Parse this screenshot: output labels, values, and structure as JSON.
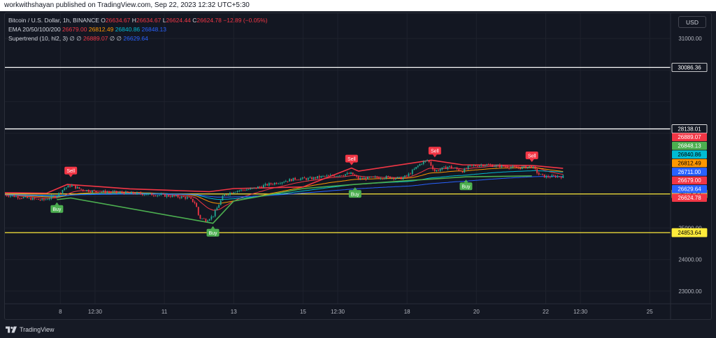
{
  "header": {
    "publisher_text": "workwithshayan published on TradingView.com, Sep 22, 2023 12:32 UTC+5:30"
  },
  "legend": {
    "symbol": "Bitcoin / U.S. Dollar, 1h, BINANCE",
    "o_label": "O",
    "o_value": "26634.67",
    "h_label": "H",
    "h_value": "26634.67",
    "l_label": "L",
    "l_value": "26624.44",
    "c_label": "C",
    "c_value": "26624.78",
    "change": "−12.89 (−0.05%)",
    "ema_label": "EMA 20/50/100/200",
    "ema_values": [
      "26679.00",
      "26812.49",
      "26840.86",
      "26848.13"
    ],
    "supertrend_label": "Supertrend (10, hl2, 3)",
    "st_placeholder": "∅",
    "st_values": [
      "26889.07",
      "26629.64"
    ]
  },
  "currency_button": "USD",
  "footer": {
    "brand": "TradingView"
  },
  "colors": {
    "background": "#131722",
    "grid": "#1e222d",
    "candle_up": "#22ab94",
    "candle_down": "#f23645",
    "supertrend_up": "#4caf50",
    "supertrend_down": "#f23645",
    "ema20": "#f23645",
    "ema50": "#ff9800",
    "ema100": "#00bcd4",
    "ema200": "#2962ff",
    "hline_white": "#ffffff",
    "hline_yellow": "#ffeb3b"
  },
  "chart_data": {
    "type": "candlestick",
    "symbol": "BTCUSD",
    "timeframe": "1h",
    "ylim": [
      22600,
      31800
    ],
    "x_ticks": [
      {
        "label": "8",
        "day": 8.0
      },
      {
        "label": "12:30",
        "day": 9.0
      },
      {
        "label": "11",
        "day": 11.0
      },
      {
        "label": "13",
        "day": 13.0
      },
      {
        "label": "15",
        "day": 15.0
      },
      {
        "label": "12:30",
        "day": 16.0
      },
      {
        "label": "18",
        "day": 18.0
      },
      {
        "label": "20",
        "day": 20.0
      },
      {
        "label": "22",
        "day": 22.0
      },
      {
        "label": "12:30",
        "day": 23.0
      },
      {
        "label": "25",
        "day": 25.0
      }
    ],
    "y_ticks": [
      31000,
      25000,
      24000,
      23000
    ],
    "y_tick_labels": [
      "31000.00",
      "25000.00",
      "24000.00",
      "23000.00"
    ],
    "horizontal_lines": [
      {
        "value": 30086.36,
        "label": "30086.36",
        "color": "white"
      },
      {
        "value": 28138.01,
        "label": "28138.01",
        "color": "white"
      },
      {
        "value": 26078.32,
        "label": "26078.32",
        "color": "yellow"
      },
      {
        "value": 24853.64,
        "label": "24853.64",
        "color": "yellow"
      }
    ],
    "price_tags": [
      {
        "label": "26889.07",
        "value": 26889.07,
        "bg": "#f23645",
        "fg": "#ffffff"
      },
      {
        "label": "26848.13",
        "value": 26848.13,
        "bg": "#4caf50",
        "fg": "#ffffff"
      },
      {
        "label": "26840.86",
        "value": 26840.86,
        "bg": "#00bcd4",
        "fg": "#000000"
      },
      {
        "label": "26812.49",
        "value": 26812.49,
        "bg": "#ff9800",
        "fg": "#000000"
      },
      {
        "label": "26711.00",
        "value": 26711.0,
        "bg": "#2962ff",
        "fg": "#ffffff"
      },
      {
        "label": "26679.00",
        "value": 26679.0,
        "bg": "#f23645",
        "fg": "#ffffff"
      },
      {
        "label": "26629.64",
        "value": 26629.64,
        "bg": "#2962ff",
        "fg": "#ffffff"
      },
      {
        "label": "26624.78",
        "value": 26624.78,
        "bg": "#f23645",
        "fg": "#ffffff"
      }
    ],
    "signals": [
      {
        "type": "Buy",
        "day": 7.9,
        "price": 25900
      },
      {
        "type": "Sell",
        "day": 8.3,
        "price": 26520
      },
      {
        "type": "Buy",
        "day": 12.4,
        "price": 25150
      },
      {
        "type": "Sell",
        "day": 16.4,
        "price": 26900
      },
      {
        "type": "Buy",
        "day": 16.5,
        "price": 26380
      },
      {
        "type": "Sell",
        "day": 18.8,
        "price": 27150
      },
      {
        "type": "Buy",
        "day": 19.7,
        "price": 26620
      },
      {
        "type": "Sell",
        "day": 21.6,
        "price": 27000
      }
    ],
    "close_path": [
      [
        6.4,
        26050
      ],
      [
        7.0,
        25950
      ],
      [
        7.5,
        25880
      ],
      [
        7.9,
        26030
      ],
      [
        8.1,
        26250
      ],
      [
        8.3,
        26350
      ],
      [
        8.6,
        26220
      ],
      [
        9.0,
        26150
      ],
      [
        9.6,
        26130
      ],
      [
        10.2,
        26090
      ],
      [
        10.8,
        26050
      ],
      [
        11.3,
        26000
      ],
      [
        11.7,
        25950
      ],
      [
        11.9,
        25780
      ],
      [
        12.0,
        25330
      ],
      [
        12.2,
        25250
      ],
      [
        12.4,
        25380
      ],
      [
        12.7,
        26020
      ],
      [
        13.0,
        26170
      ],
      [
        13.5,
        26230
      ],
      [
        14.0,
        26380
      ],
      [
        14.4,
        26470
      ],
      [
        14.8,
        26560
      ],
      [
        15.2,
        26560
      ],
      [
        15.5,
        26620
      ],
      [
        15.9,
        26660
      ],
      [
        16.2,
        26700
      ],
      [
        16.4,
        26720
      ],
      [
        16.6,
        26560
      ],
      [
        17.0,
        26590
      ],
      [
        17.5,
        26610
      ],
      [
        17.8,
        26570
      ],
      [
        18.0,
        26650
      ],
      [
        18.2,
        26850
      ],
      [
        18.4,
        27050
      ],
      [
        18.6,
        27150
      ],
      [
        18.8,
        26800
      ],
      [
        19.2,
        26950
      ],
      [
        19.6,
        26800
      ],
      [
        19.8,
        26950
      ],
      [
        20.2,
        27000
      ],
      [
        20.8,
        26950
      ],
      [
        21.2,
        26900
      ],
      [
        21.6,
        26950
      ],
      [
        21.8,
        26700
      ],
      [
        22.0,
        26620
      ],
      [
        22.3,
        26640
      ],
      [
        22.5,
        26625
      ]
    ],
    "supertrend_down": [
      [
        6.4,
        26120
      ],
      [
        7.6,
        26100
      ],
      [
        8.2,
        26380
      ],
      [
        9.0,
        26320
      ],
      [
        10.0,
        26240
      ],
      [
        11.0,
        26200
      ],
      [
        12.3,
        26150
      ],
      [
        13.0,
        26250
      ],
      [
        15.0,
        26300
      ],
      [
        16.4,
        26900
      ],
      [
        16.6,
        26800
      ],
      [
        18.7,
        27150
      ],
      [
        19.6,
        27000
      ],
      [
        21.6,
        26980
      ],
      [
        22.5,
        26889
      ]
    ],
    "supertrend_up": [
      [
        7.9,
        25900
      ],
      [
        8.3,
        25950
      ],
      [
        12.4,
        25150
      ],
      [
        13.0,
        25850
      ],
      [
        15.0,
        26250
      ],
      [
        16.5,
        26380
      ],
      [
        18.0,
        26500
      ],
      [
        19.7,
        26620
      ],
      [
        21.6,
        26650
      ]
    ]
  }
}
